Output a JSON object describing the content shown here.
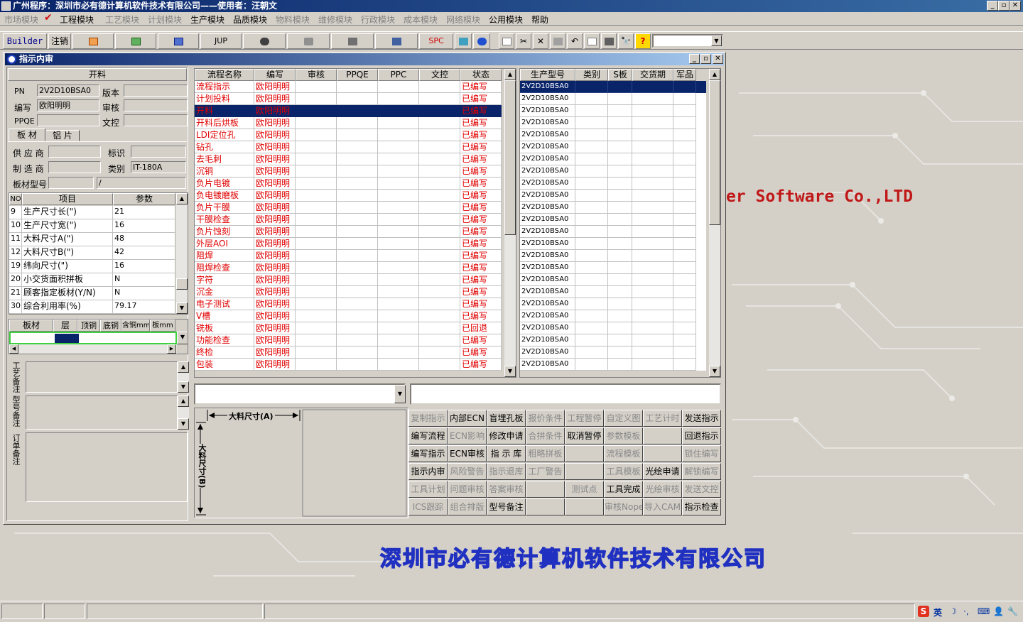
{
  "window": {
    "title": "广州程序：深圳市必有德计算机软件技术有限公司——使用者：汪朝文"
  },
  "menu": [
    {
      "label": "市场模块",
      "enabled": false
    },
    {
      "label": "工程模块",
      "enabled": true
    },
    {
      "label": "工艺模块",
      "enabled": false
    },
    {
      "label": "计划模块",
      "enabled": false
    },
    {
      "label": "生产模块",
      "enabled": true
    },
    {
      "label": "品质模块",
      "enabled": true
    },
    {
      "label": "物料模块",
      "enabled": false
    },
    {
      "label": "维修模块",
      "enabled": false
    },
    {
      "label": "行政模块",
      "enabled": false
    },
    {
      "label": "成本模块",
      "enabled": false
    },
    {
      "label": "网络模块",
      "enabled": false
    },
    {
      "label": "公用模块",
      "enabled": true
    },
    {
      "label": "帮助",
      "enabled": true
    }
  ],
  "toolbar": {
    "builder": "Builder",
    "logout": "注销",
    "jup": "JUP",
    "spc": "SPC"
  },
  "child": {
    "title": "指示内审",
    "left": {
      "section_title": "开料",
      "pn_label": "PN",
      "pn_value": "2V2D10BSA0",
      "version_label": "版本",
      "version_value": "",
      "author_label": "编写",
      "author_value": "欧阳明明",
      "review_label": "审核",
      "review_value": "",
      "ppqe_label": "PPQE",
      "ppqe_value": "",
      "doc_label": "文控",
      "doc_value": "",
      "tab1": "板 材",
      "tab2": "铝 片",
      "supplier_label": "供 应 商",
      "supplier_value": "",
      "mark_label": "标识",
      "mark_value": "",
      "maker_label": "制 造 商",
      "maker_value": "",
      "type_label": "类别",
      "type_value": "IT-180A",
      "model_label": "板材型号",
      "model_value": "",
      "model_value2": "/",
      "params_headers": [
        "NO",
        "项目",
        "参数"
      ],
      "params": [
        {
          "no": "9",
          "item": "生产尺寸长(\")",
          "val": "21"
        },
        {
          "no": "10",
          "item": "生产尺寸宽(\")",
          "val": "16"
        },
        {
          "no": "11",
          "item": "大料尺寸A(\")",
          "val": "48"
        },
        {
          "no": "12",
          "item": "大料尺寸B(\")",
          "val": "42"
        },
        {
          "no": "19",
          "item": "纬向尺寸(\")",
          "val": "16"
        },
        {
          "no": "20",
          "item": "小交货面积拼板",
          "val": "N"
        },
        {
          "no": "21",
          "item": "顾客指定板材(Y/N)",
          "val": "N"
        },
        {
          "no": "30",
          "item": "综合利用率(%)",
          "val": "79.17"
        }
      ],
      "layer_headers": [
        "板材",
        "层",
        "顶铜",
        "底铜",
        "含铜mm",
        "板mm"
      ],
      "remark1_label": "工艺备注",
      "remark2_label": "型号备注",
      "remark3_label": "订单备注"
    },
    "flow": {
      "headers": [
        "流程名称",
        "编写",
        "审核",
        "PPQE",
        "PPC",
        "文控",
        "状态"
      ],
      "rows": [
        {
          "name": "流程指示",
          "author": "欧阳明明",
          "status": "已编写"
        },
        {
          "name": "计划投料",
          "author": "欧阳明明",
          "status": "已编写"
        },
        {
          "name": "开料",
          "author": "欧阳明明",
          "status": "已编写",
          "selected": true
        },
        {
          "name": "开料后烘板",
          "author": "欧阳明明",
          "status": "已编写"
        },
        {
          "name": "LDI定位孔",
          "author": "欧阳明明",
          "status": "已编写"
        },
        {
          "name": "钻孔",
          "author": "欧阳明明",
          "status": "已编写"
        },
        {
          "name": "去毛刺",
          "author": "欧阳明明",
          "status": "已编写"
        },
        {
          "name": "沉铜",
          "author": "欧阳明明",
          "status": "已编写"
        },
        {
          "name": "负片电镀",
          "author": "欧阳明明",
          "status": "已编写"
        },
        {
          "name": "负电镀磨板",
          "author": "欧阳明明",
          "status": "已编写"
        },
        {
          "name": "负片干膜",
          "author": "欧阳明明",
          "status": "已编写"
        },
        {
          "name": "干膜检查",
          "author": "欧阳明明",
          "status": "已编写"
        },
        {
          "name": "负片蚀刻",
          "author": "欧阳明明",
          "status": "已编写"
        },
        {
          "name": "外层AOI",
          "author": "欧阳明明",
          "status": "已编写"
        },
        {
          "name": "阻焊",
          "author": "欧阳明明",
          "status": "已编写"
        },
        {
          "name": "阻焊检查",
          "author": "欧阳明明",
          "status": "已编写"
        },
        {
          "name": "字符",
          "author": "欧阳明明",
          "status": "已编写"
        },
        {
          "name": "沉金",
          "author": "欧阳明明",
          "status": "已编写"
        },
        {
          "name": "电子测试",
          "author": "欧阳明明",
          "status": "已编写"
        },
        {
          "name": "V槽",
          "author": "欧阳明明",
          "status": "已编写"
        },
        {
          "name": "铣板",
          "author": "欧阳明明",
          "status": "已回退"
        },
        {
          "name": "功能检查",
          "author": "欧阳明明",
          "status": "已编写"
        },
        {
          "name": "终检",
          "author": "欧阳明明",
          "status": "已编写"
        },
        {
          "name": "包装",
          "author": "欧阳明明",
          "status": "已编写"
        }
      ]
    },
    "models": {
      "headers": [
        "生产型号",
        "类别",
        "S板",
        "交货期",
        "军品"
      ],
      "rows": [
        "2V2D10BSA0",
        "2V2D10BSA0",
        "2V2D10BSA0",
        "2V2D10BSA0",
        "2V2D10BSA0",
        "2V2D10BSA0",
        "2V2D10BSA0",
        "2V2D10BSA0",
        "2V2D10BSA0",
        "2V2D10BSA0",
        "2V2D10BSA0",
        "2V2D10BSA0",
        "2V2D10BSA0",
        "2V2D10BSA0",
        "2V2D10BSA0",
        "2V2D10BSA0",
        "2V2D10BSA0",
        "2V2D10BSA0",
        "2V2D10BSA0",
        "2V2D10BSA0",
        "2V2D10BSA0",
        "2V2D10BSA0",
        "2V2D10BSA0",
        "2V2D10BSA0"
      ]
    },
    "diagram": {
      "a_label": "大料尺寸(A)",
      "b_label": "大料尺寸(B)"
    },
    "buttons": [
      [
        {
          "l": "复制指示",
          "e": false
        },
        {
          "l": "内部ECN",
          "e": true
        },
        {
          "l": "盲埋孔板",
          "e": true
        },
        {
          "l": "报价条件",
          "e": false
        },
        {
          "l": "工程暂停",
          "e": false
        },
        {
          "l": "自定义图",
          "e": false
        },
        {
          "l": "工艺计时",
          "e": false
        },
        {
          "l": "发送指示",
          "e": true
        }
      ],
      [
        {
          "l": "编写流程",
          "e": true
        },
        {
          "l": "ECN影响",
          "e": false
        },
        {
          "l": "修改申请",
          "e": true
        },
        {
          "l": "合拼条件",
          "e": false
        },
        {
          "l": "取消暂停",
          "e": true
        },
        {
          "l": "参数模板",
          "e": false
        },
        {
          "l": "",
          "e": false
        },
        {
          "l": "回退指示",
          "e": true
        }
      ],
      [
        {
          "l": "编写指示",
          "e": true
        },
        {
          "l": "ECN审核",
          "e": true
        },
        {
          "l": "指 示 库",
          "e": true
        },
        {
          "l": "粗略拼板",
          "e": false
        },
        {
          "l": "",
          "e": false
        },
        {
          "l": "流程模板",
          "e": false
        },
        {
          "l": "",
          "e": false
        },
        {
          "l": "锁住编写",
          "e": false
        }
      ],
      [
        {
          "l": "指示内审",
          "e": true
        },
        {
          "l": "风险警告",
          "e": false
        },
        {
          "l": "指示退库",
          "e": false
        },
        {
          "l": "工厂警告",
          "e": false
        },
        {
          "l": "",
          "e": false
        },
        {
          "l": "工具模板",
          "e": false
        },
        {
          "l": "光绘申请",
          "e": true
        },
        {
          "l": "解锁编写",
          "e": false
        }
      ],
      [
        {
          "l": "工具计划",
          "e": false
        },
        {
          "l": "问题审核",
          "e": false
        },
        {
          "l": "答案审核",
          "e": false
        },
        {
          "l": "",
          "e": false
        },
        {
          "l": "测试点",
          "e": false
        },
        {
          "l": "工具完成",
          "e": true
        },
        {
          "l": "光绘审核",
          "e": false
        },
        {
          "l": "发送文控",
          "e": false
        }
      ],
      [
        {
          "l": "ICS跟踪",
          "e": false
        },
        {
          "l": "组合排版",
          "e": false
        },
        {
          "l": "型号备注",
          "e": true
        },
        {
          "l": "",
          "e": false
        },
        {
          "l": "",
          "e": false
        },
        {
          "l": "审核Nope",
          "e": false
        },
        {
          "l": "导入CAM",
          "e": false
        },
        {
          "l": "指示检查",
          "e": true
        }
      ]
    ]
  },
  "background": {
    "company": "深圳市必有德计算机软件技术有限公司",
    "software": "er Software Co.,LTD"
  },
  "tray": {
    "ime": "英"
  },
  "colors": {
    "accent": "#0a246a",
    "text_red": "#e00000",
    "highlight_green": "#40d040"
  }
}
